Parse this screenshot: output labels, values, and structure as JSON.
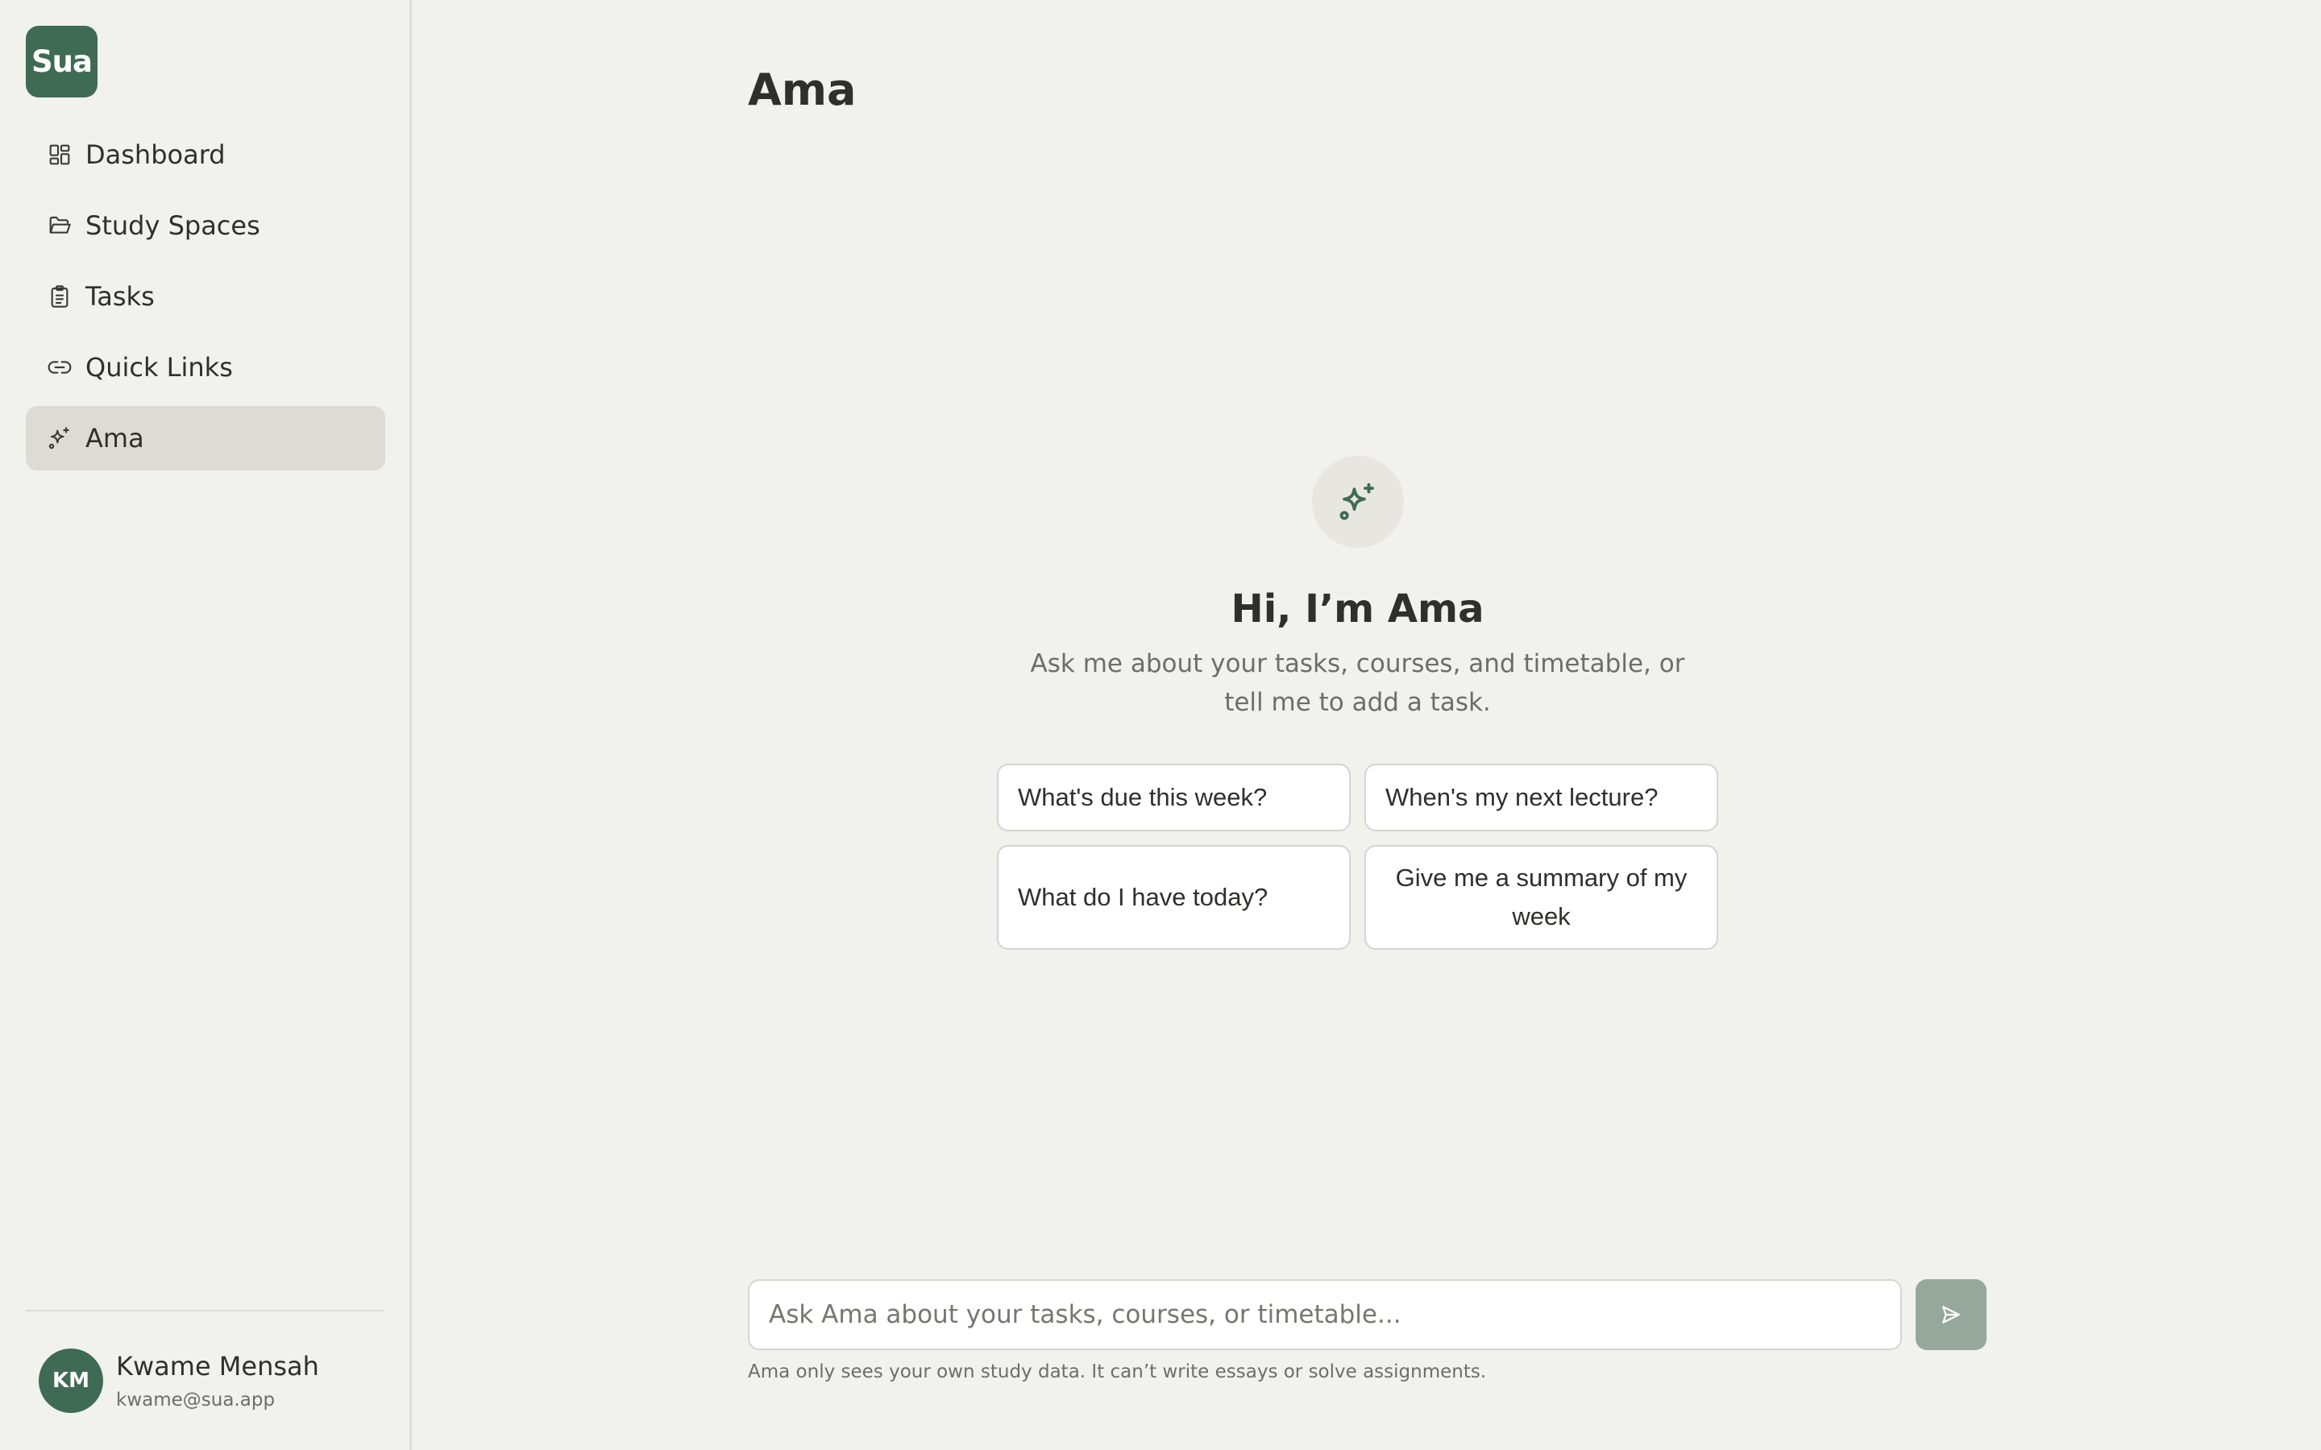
{
  "brand": {
    "logo_text": "Sua",
    "accent_color": "#3f6b55"
  },
  "sidebar": {
    "items": [
      {
        "label": "Dashboard",
        "icon": "grid-icon"
      },
      {
        "label": "Study Spaces",
        "icon": "folder-icon"
      },
      {
        "label": "Tasks",
        "icon": "clipboard-icon"
      },
      {
        "label": "Quick Links",
        "icon": "link-icon"
      },
      {
        "label": "Ama",
        "icon": "sparkles-icon",
        "active": true
      }
    ]
  },
  "user": {
    "initials": "KM",
    "name": "Kwame Mensah",
    "email": "kwame@sua.app"
  },
  "main": {
    "title": "Ama",
    "greeting": "Hi, I’m Ama",
    "subtitle": "Ask me about your tasks, courses, and timetable, or tell me to add a task.",
    "suggestions": [
      "What's due this week?",
      "When's my next lecture?",
      "What do I have today?",
      "Give me a summary of my week"
    ],
    "composer": {
      "placeholder": "Ask Ama about your tasks, courses, or timetable...",
      "value": ""
    },
    "footnote": "Ama only sees your own study data. It can’t write essays or solve assignments."
  }
}
